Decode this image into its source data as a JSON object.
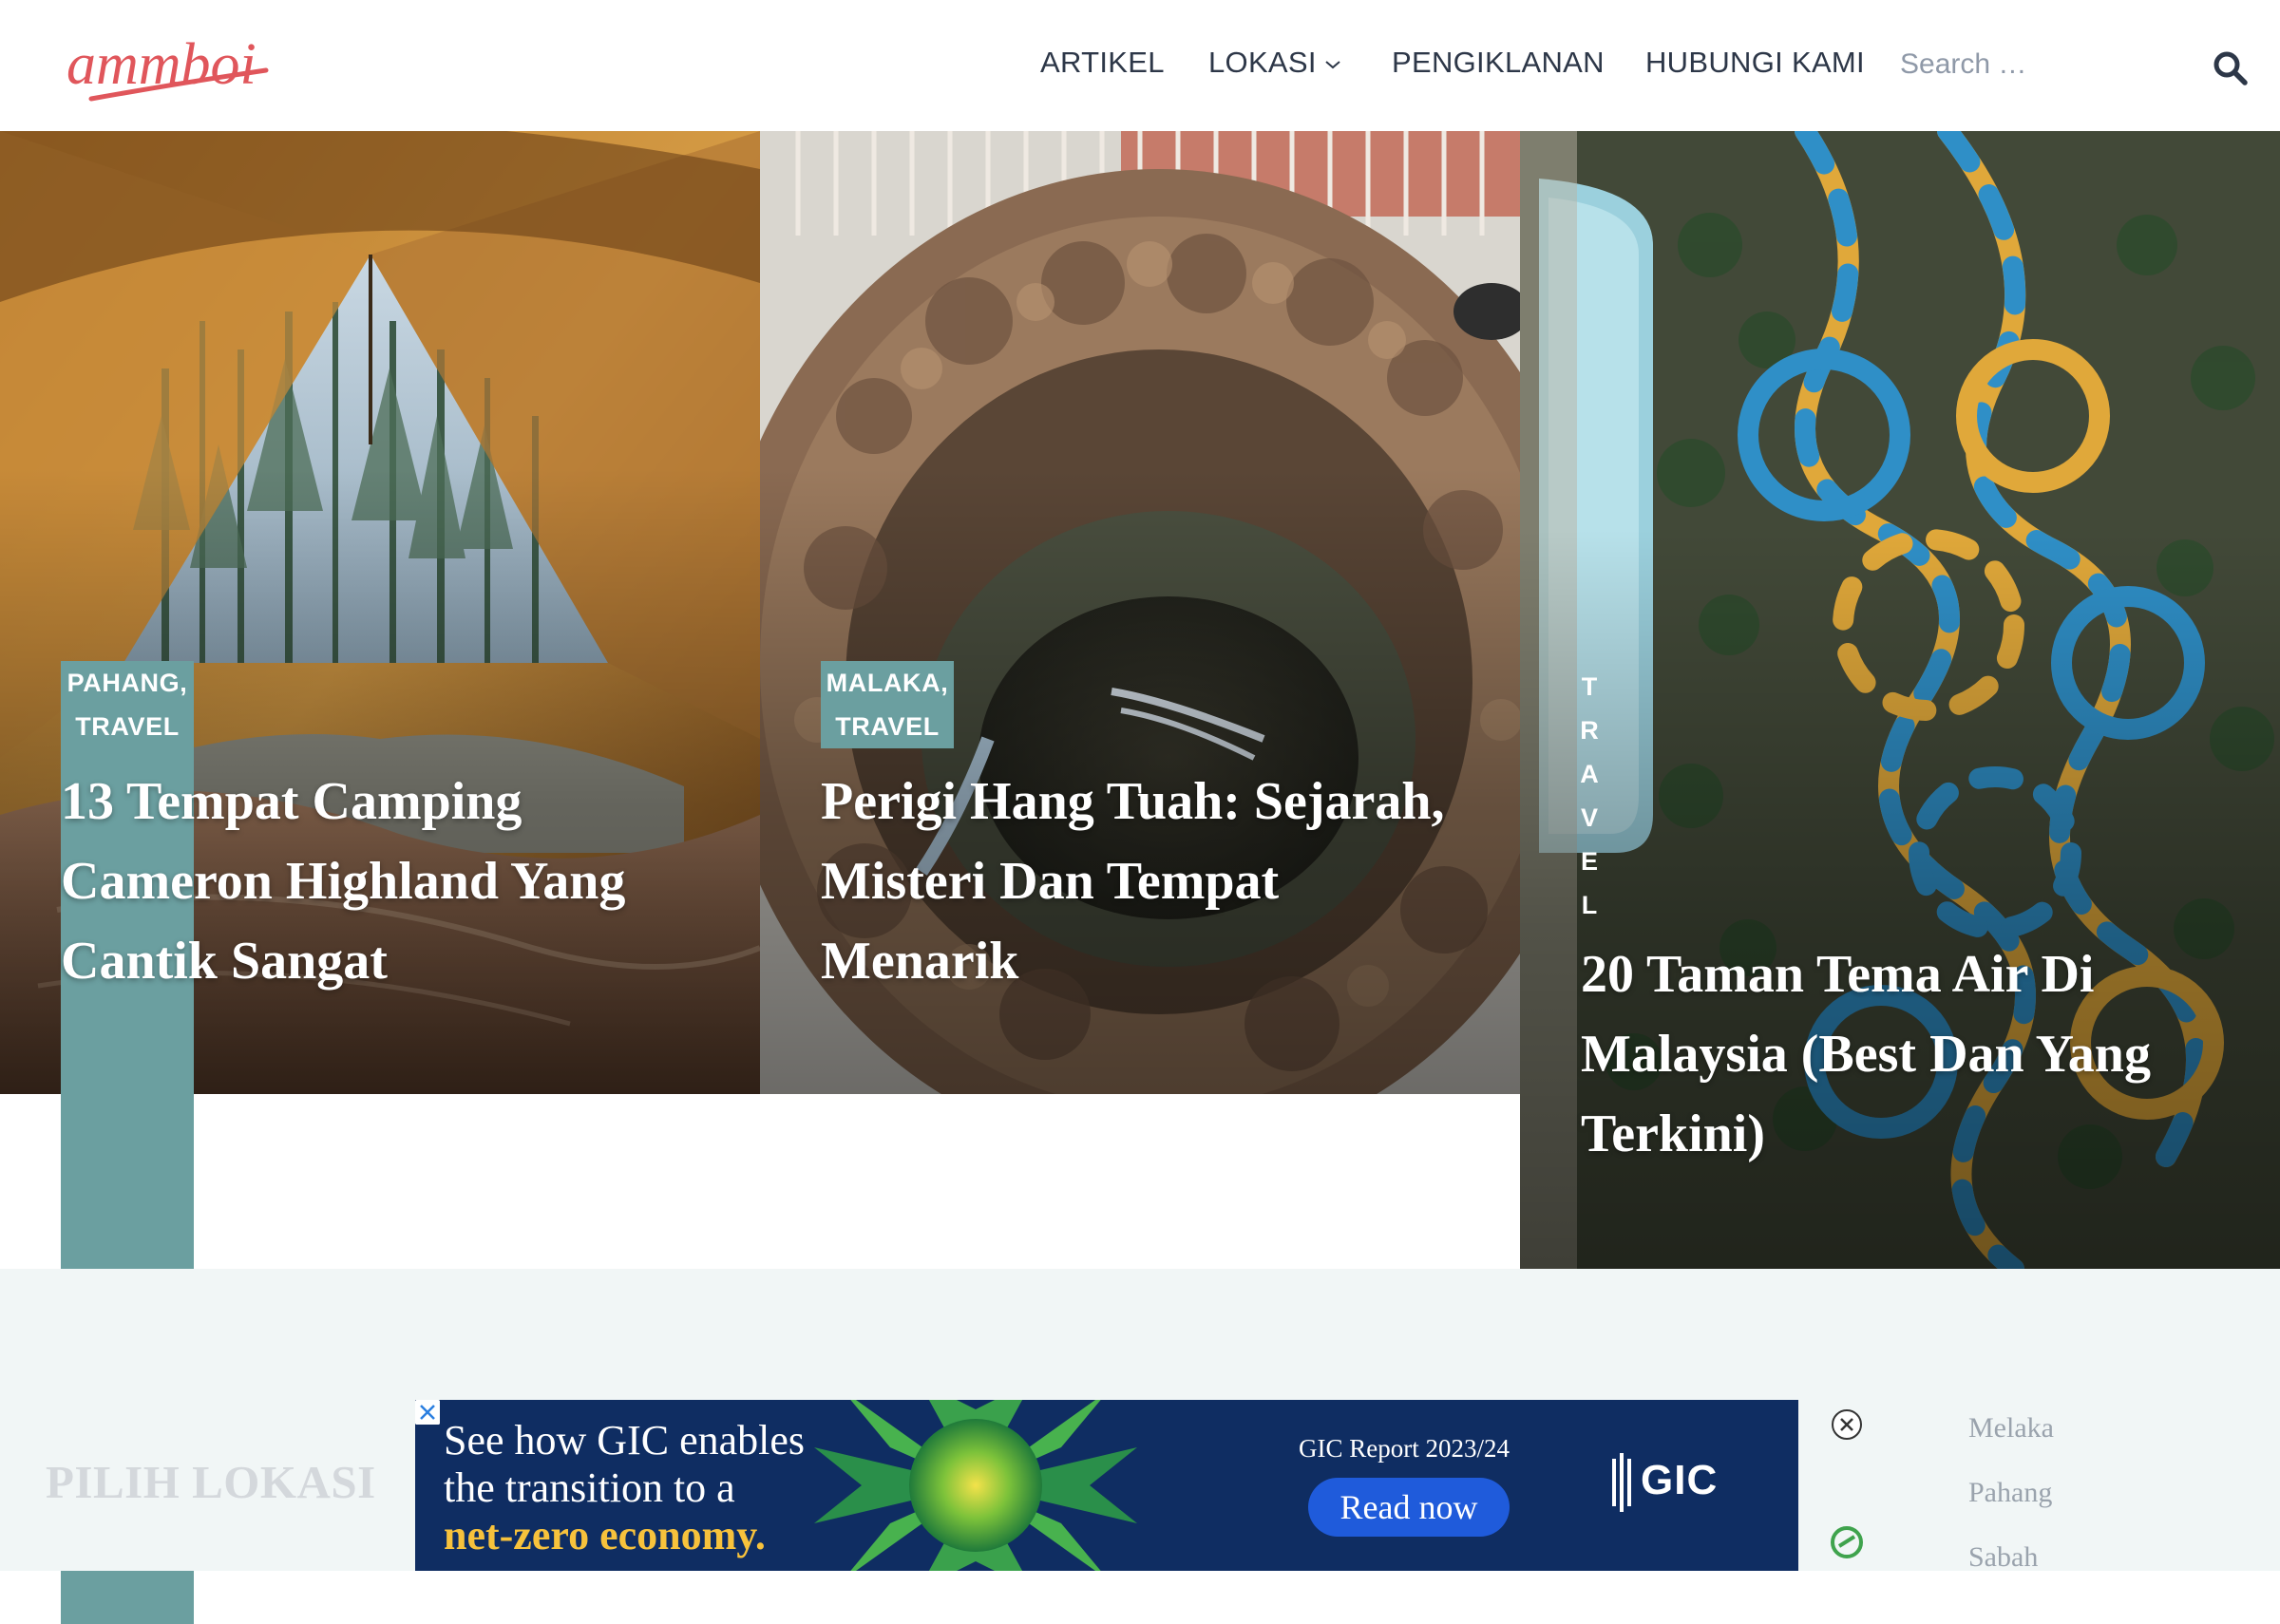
{
  "header": {
    "logo_text": "ammboi",
    "nav": [
      {
        "label": "ARTIKEL"
      },
      {
        "label": "LOKASI"
      },
      {
        "label": "PENGIKLANAN"
      },
      {
        "label": "HUBUNGI KAMI"
      }
    ],
    "search": {
      "placeholder": "Search …"
    }
  },
  "hero": [
    {
      "categories": [
        "PAHANG,",
        "TRAVEL"
      ],
      "title": "13 Tempat Camping Cameron Highland Yang Cantik Sangat"
    },
    {
      "categories": [
        "MALAKA,",
        "TRAVEL"
      ],
      "title": "Perigi Hang Tuah: Sejarah, Misteri Dan Tempat Menarik"
    },
    {
      "categories": [
        "TRAVEL"
      ],
      "vertical_letters": [
        "T",
        "R",
        "A",
        "V",
        "E",
        "L"
      ],
      "title": "20 Taman Tema Air Di Malaysia (Best Dan Yang Terkini)"
    }
  ],
  "section": {
    "heading": "PILIH LOKASI"
  },
  "ad": {
    "headline_line1": "See how GIC enables",
    "headline_line2": "the transition to a",
    "headline_highlight": "net-zero economy.",
    "report": "GIC Report 2023/24",
    "cta": "Read now",
    "brand": "GIC"
  },
  "locations": [
    "Melaka",
    "Pahang",
    "Sabah"
  ],
  "colors": {
    "logo": "#e0565b",
    "nav_text": "#2d3748",
    "badge": "#6b9fa0",
    "section_bg": "#f1f6f6",
    "ad_bg": "#0f2d62",
    "ad_highlight": "#f7c23c",
    "ad_button": "#1f5bdb"
  }
}
